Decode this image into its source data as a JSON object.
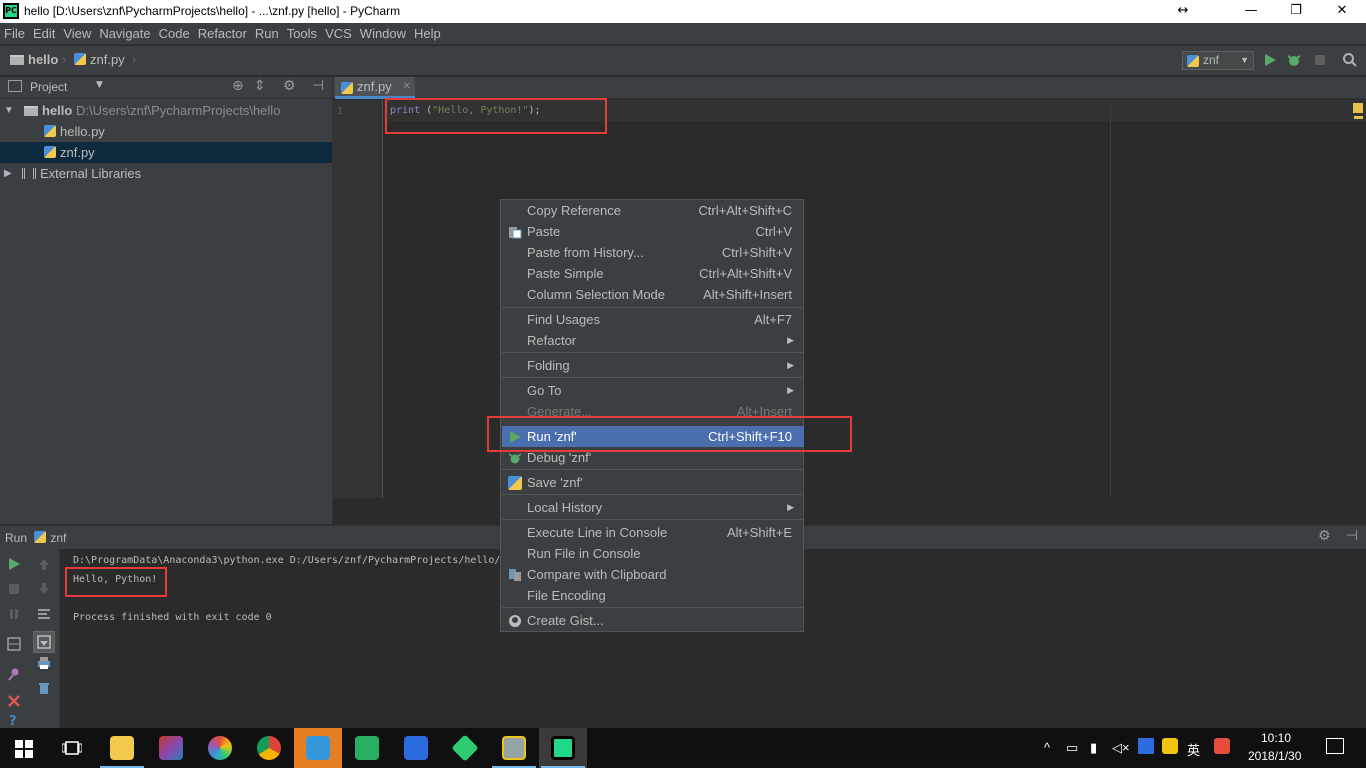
{
  "window": {
    "title": "hello [D:\\Users\\znf\\PycharmProjects\\hello] - ...\\znf.py [hello] - PyCharm",
    "app_icon_text": "PC",
    "resize_glyph": "↔",
    "min_glyph": "—",
    "restore_glyph": "❐",
    "close_glyph": "✕"
  },
  "menu": [
    "File",
    "Edit",
    "View",
    "Navigate",
    "Code",
    "Refactor",
    "Run",
    "Tools",
    "VCS",
    "Window",
    "Help"
  ],
  "breadcrumb": {
    "project": "hello",
    "file": "znf.py"
  },
  "toolbar": {
    "run_config": "znf"
  },
  "project_panel": {
    "header": "Project",
    "root_name": "hello",
    "root_path": "D:\\Users\\znf\\PycharmProjects\\hello",
    "files": [
      "hello.py",
      "znf.py"
    ],
    "external": "External Libraries"
  },
  "editor": {
    "tab_label": "znf.py",
    "line_number": "1",
    "code": {
      "keyword": "print",
      "open": " (",
      "string": "\"Hello, Python!\"",
      "close": ");"
    }
  },
  "context_menu": {
    "items": [
      {
        "label": "Copy Reference",
        "shortcut": "Ctrl+Alt+Shift+C"
      },
      {
        "label": "Paste",
        "shortcut": "Ctrl+V"
      },
      {
        "label": "Paste from History...",
        "shortcut": "Ctrl+Shift+V"
      },
      {
        "label": "Paste Simple",
        "shortcut": "Ctrl+Alt+Shift+V"
      },
      {
        "label": "Column Selection Mode",
        "shortcut": "Alt+Shift+Insert"
      },
      {
        "label": "Find Usages",
        "shortcut": "Alt+F7"
      },
      {
        "label": "Refactor",
        "shortcut": ""
      },
      {
        "label": "Folding",
        "shortcut": ""
      },
      {
        "label": "Go To",
        "shortcut": ""
      },
      {
        "label": "Generate...",
        "shortcut": "Alt+Insert"
      },
      {
        "label": "Run 'znf'",
        "shortcut": "Ctrl+Shift+F10"
      },
      {
        "label": "Debug 'znf'",
        "shortcut": ""
      },
      {
        "label": "Save 'znf'",
        "shortcut": ""
      },
      {
        "label": "Local History",
        "shortcut": ""
      },
      {
        "label": "Execute Line in Console",
        "shortcut": "Alt+Shift+E"
      },
      {
        "label": "Run File in Console",
        "shortcut": ""
      },
      {
        "label": "Compare with Clipboard",
        "shortcut": ""
      },
      {
        "label": "File Encoding",
        "shortcut": ""
      },
      {
        "label": "Create Gist...",
        "shortcut": ""
      }
    ]
  },
  "run_panel": {
    "label": "Run",
    "config": "znf",
    "console": [
      "D:\\ProgramData\\Anaconda3\\python.exe D:/Users/znf/PycharmProjects/hello/z",
      "Hello, Python!",
      "Process finished with exit code 0"
    ]
  },
  "taskbar": {
    "ime": "英",
    "time": "10:10",
    "date": "2018/1/30"
  }
}
